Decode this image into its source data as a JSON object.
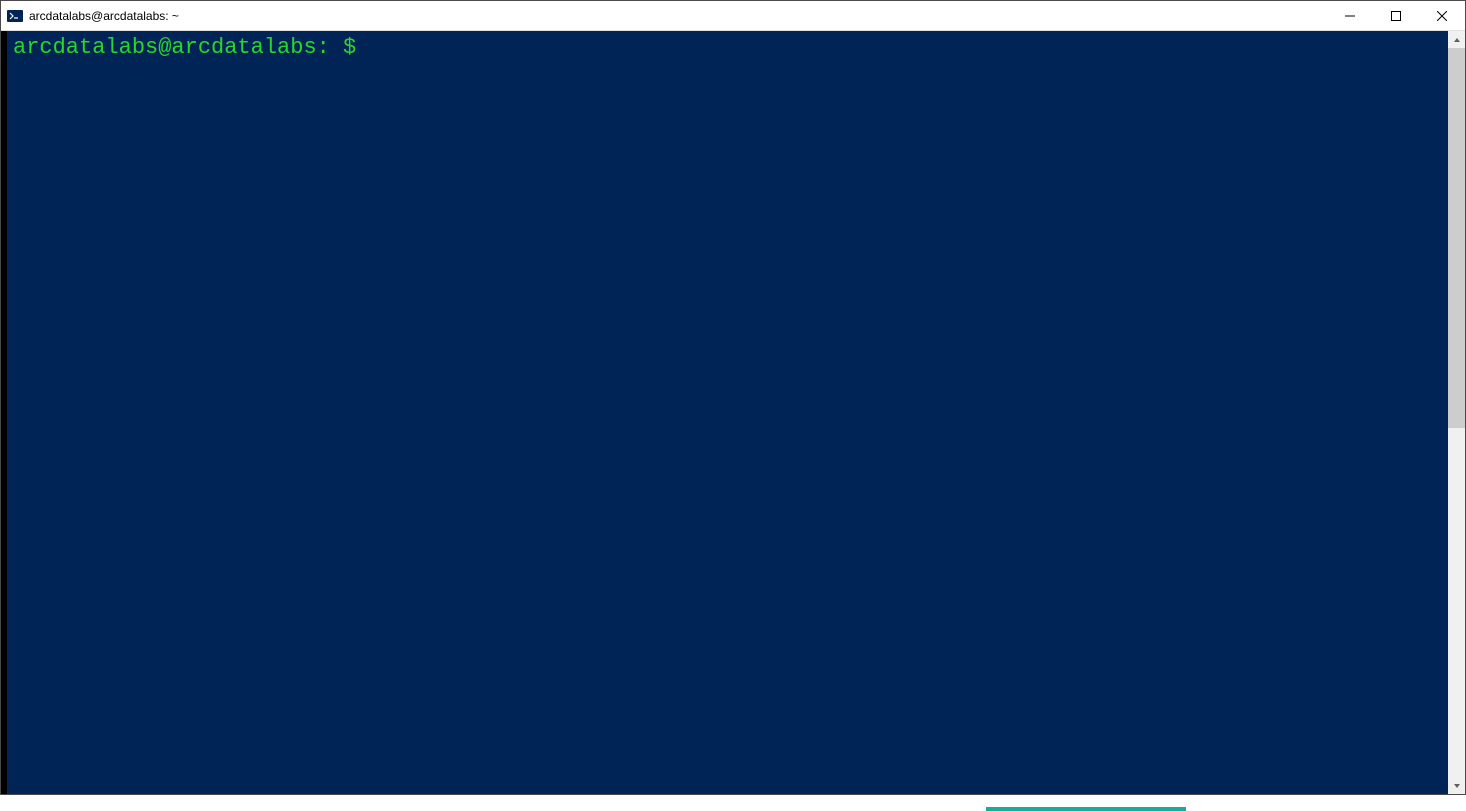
{
  "window": {
    "title": "arcdatalabs@arcdatalabs: ~"
  },
  "terminal": {
    "prompt_user": "arcdatalabs@arcdatalabs:",
    "prompt_symbol": " $"
  },
  "colors": {
    "terminal_bg": "#012456",
    "prompt_green": "#29d629"
  }
}
